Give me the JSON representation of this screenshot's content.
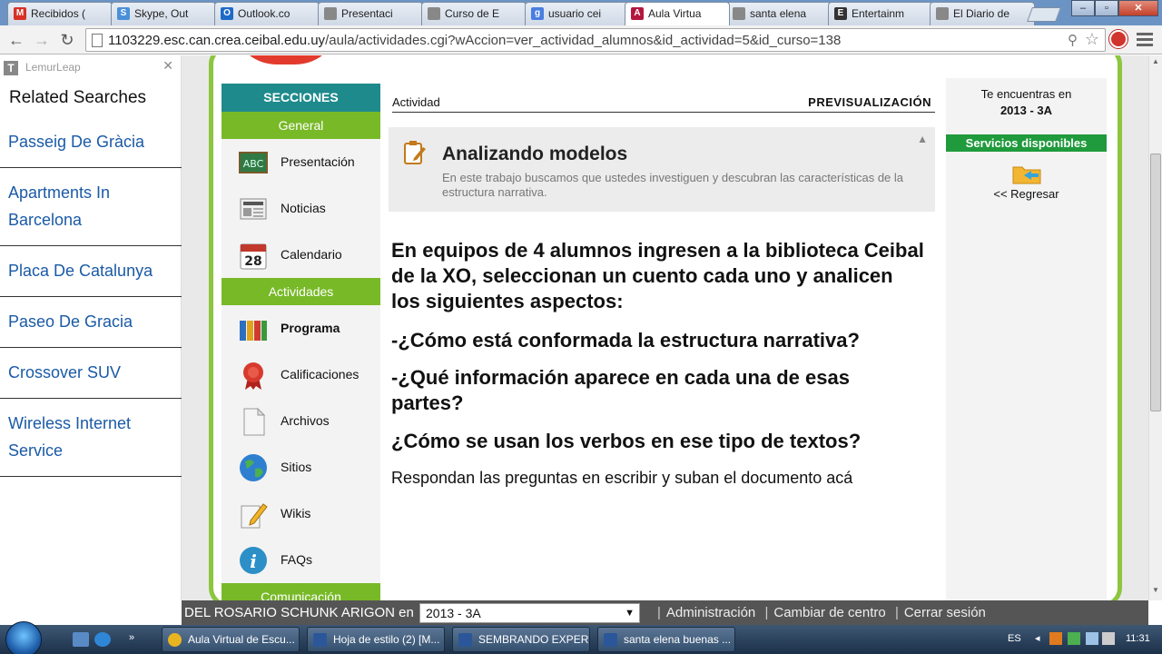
{
  "browser": {
    "tabs": [
      {
        "label": "Recibidos (",
        "icon": "gmail-icon",
        "color": "#d93025"
      },
      {
        "label": "Skype, Out",
        "icon": "skype-icon",
        "color": "#4a90d9"
      },
      {
        "label": "Outlook.co",
        "icon": "outlook-icon",
        "color": "#1e6ac8"
      },
      {
        "label": "Presentaci",
        "icon": "doc-icon",
        "color": "#888888"
      },
      {
        "label": "Curso de E",
        "icon": "doc-icon",
        "color": "#888888"
      },
      {
        "label": "usuario cei",
        "icon": "google-icon",
        "color": "#4a7ee0"
      },
      {
        "label": "Aula Virtua",
        "icon": "aula-icon",
        "color": "#b3173e"
      },
      {
        "label": "santa elena",
        "icon": "doc-icon",
        "color": "#888888"
      },
      {
        "label": "Entertainm",
        "icon": "entertainment-icon",
        "color": "#333333"
      },
      {
        "label": "El Diario de",
        "icon": "doc-icon",
        "color": "#888888"
      }
    ],
    "active_tab_index": 6,
    "url_host": "1103229.esc.can.crea.ceibal.edu.uy",
    "url_path": "/aula/actividades.cgi?wAccion=ver_actividad_alumnos&id_actividad=5&id_curso=138"
  },
  "sidebar": {
    "brand": "LemurLeap",
    "title": "Related Searches",
    "items": [
      "Passeig De Gràcia",
      "Apartments In Barcelona",
      "Placa De Catalunya",
      "Paseo De Gracia",
      "Crossover SUV",
      "Wireless Internet Service"
    ]
  },
  "nav": {
    "header": "SECCIONES",
    "group_general": "General",
    "general_items": [
      "Presentación",
      "Noticias",
      "Calendario"
    ],
    "group_actividades": "Actividades",
    "actividades_items": [
      "Programa",
      "Calificaciones",
      "Archivos",
      "Sitios",
      "Wikis",
      "FAQs"
    ],
    "group_comunicacion": "Comunicación"
  },
  "content": {
    "breadcrumb": "Actividad",
    "preview_label": "PREVISUALIZACIÓN",
    "activity_title": "Analizando modelos",
    "activity_desc": "En este trabajo buscamos que ustedes investiguen y descubran las características de la estructura narrativa.",
    "intro": "En equipos de 4 alumnos ingresen a la biblioteca Ceibal de la XO, seleccionan un cuento cada uno y analicen los siguientes aspectos:",
    "q1": "-¿Cómo está conformada la estructura narrativa?",
    "q2": "-¿Qué información aparece en cada una de esas partes?",
    "q3": "¿Cómo se usan los verbos en ese tipo de textos?",
    "closing": "Respondan las preguntas en escribir y suban el documento acá"
  },
  "right_panel": {
    "location_label": "Te encuentras en",
    "year": "2013 - 3A",
    "services_label": "Servicios disponibles",
    "back_label": "<< Regresar"
  },
  "bottom_bar": {
    "user_text": "DEL ROSARIO SCHUNK ARIGON  en",
    "course_select": "2013 - 3A",
    "links": [
      "Administración",
      "Cambiar de centro",
      "Cerrar sesión"
    ]
  },
  "taskbar": {
    "tasks": [
      "Aula Virtual de Escu...",
      "Hoja de estilo (2) [M...",
      "SEMBRANDO EXPER...",
      "santa elena buenas ..."
    ],
    "language": "ES",
    "clock": "11:31"
  },
  "colors": {
    "accent_green": "#78b928",
    "teal_header": "#1f8a8c",
    "services_green": "#1f9a3c",
    "link_blue": "#1a5aa6"
  }
}
